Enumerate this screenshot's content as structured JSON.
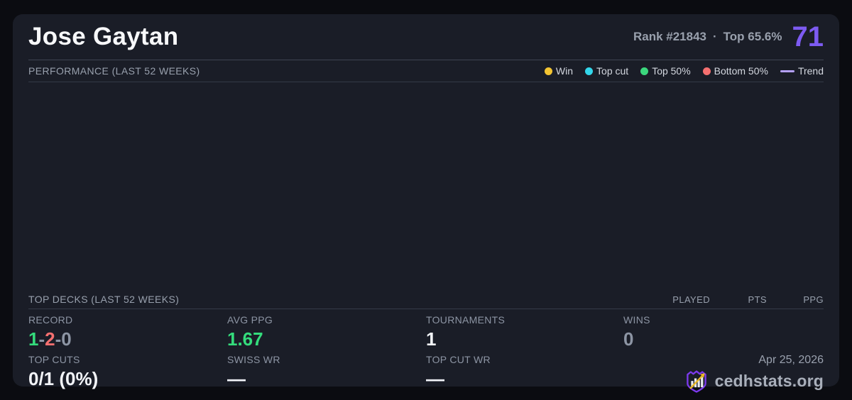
{
  "colors": {
    "accent_purple": "#7d5bf2",
    "win_yellow": "#f3c432",
    "top_cut_cyan": "#33d6ea",
    "top50_green": "#3bd77d",
    "bottom50_red": "#f57070",
    "trend_purple": "#b4a0f8",
    "card_bg": "#1a1d27",
    "page_bg": "#0b0c11"
  },
  "header": {
    "player_name": "Jose Gaytan",
    "rank": "Rank #21843",
    "separator": "·",
    "top_percent": "Top 65.6%",
    "score": "71"
  },
  "performance": {
    "title": "PERFORMANCE (LAST 52 WEEKS)",
    "legend": [
      {
        "label": "Win",
        "swatch": "background:#f3c432"
      },
      {
        "label": "Top cut",
        "swatch": "background:#33d6ea"
      },
      {
        "label": "Top 50%",
        "swatch": "background:#3bd77d"
      },
      {
        "label": "Bottom 50%",
        "swatch": "background:#f57070"
      },
      {
        "label": "Trend",
        "swatch": "background:#b4a0f8"
      }
    ]
  },
  "top_decks": {
    "title": "TOP DECKS (LAST 52 WEEKS)",
    "columns": [
      "PLAYED",
      "PTS",
      "PPG"
    ]
  },
  "stats": {
    "record": {
      "label": "RECORD",
      "wins": "1",
      "losses": "2",
      "draws": "0",
      "dash": "-"
    },
    "avg_ppg": {
      "label": "AVG PPG",
      "value": "1.67"
    },
    "tournaments": {
      "label": "TOURNAMENTS",
      "value": "1"
    },
    "wins": {
      "label": "WINS",
      "value": "0"
    },
    "top_cuts": {
      "label": "TOP CUTS",
      "value": "0/1 (0%)"
    },
    "swiss_wr": {
      "label": "SWISS WR",
      "value": "—"
    },
    "top_cut_wr": {
      "label": "TOP CUT WR",
      "value": "—"
    }
  },
  "footer": {
    "date": "Apr 25, 2026",
    "brand": "cedhstats.org"
  }
}
